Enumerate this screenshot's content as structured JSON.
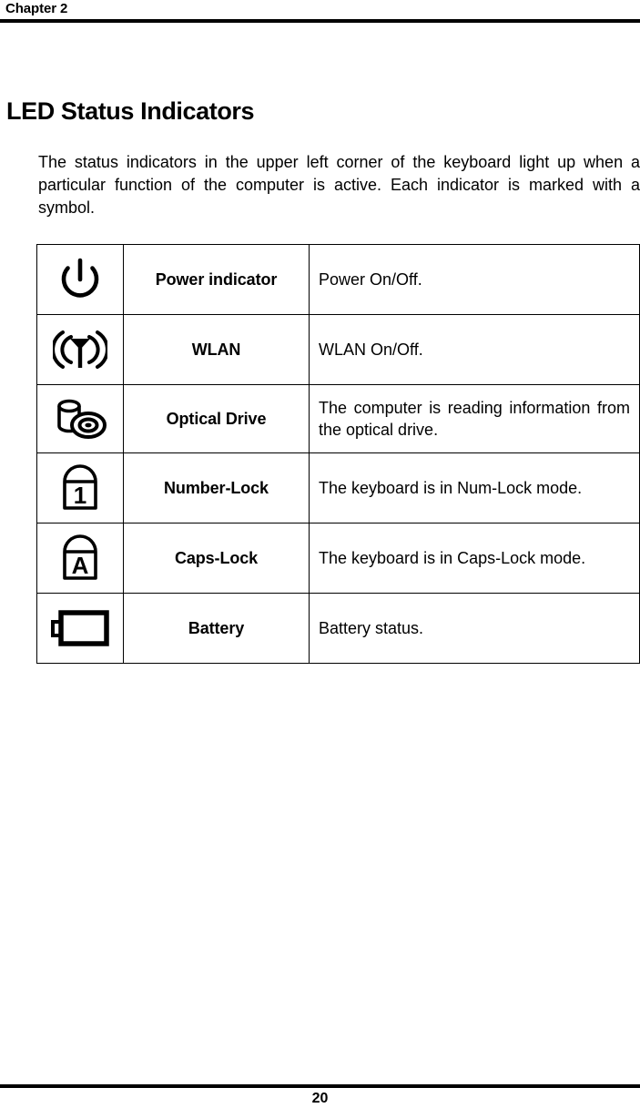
{
  "header": {
    "chapter_label": "Chapter 2"
  },
  "section": {
    "title": "LED Status Indicators",
    "intro": "The status indicators in the upper left corner of the keyboard light up when a particular function of the computer is active. Each indicator is marked with a symbol."
  },
  "table": {
    "rows": [
      {
        "icon": "power-icon",
        "name": "Power indicator",
        "description": "Power On/Off."
      },
      {
        "icon": "wlan-antenna-icon",
        "name": "WLAN",
        "description": "WLAN On/Off."
      },
      {
        "icon": "optical-drive-icon",
        "name": "Optical Drive",
        "description": "The computer is reading information from the optical drive."
      },
      {
        "icon": "number-lock-icon",
        "icon_glyph": "1",
        "name": "Number-Lock",
        "description": "The keyboard is in Num-Lock mode."
      },
      {
        "icon": "caps-lock-icon",
        "icon_glyph": "A",
        "name": "Caps-Lock",
        "description": "The keyboard is in Caps-Lock mode."
      },
      {
        "icon": "battery-icon",
        "name": "Battery",
        "description": "Battery status."
      }
    ]
  },
  "footer": {
    "page_number": "20"
  }
}
